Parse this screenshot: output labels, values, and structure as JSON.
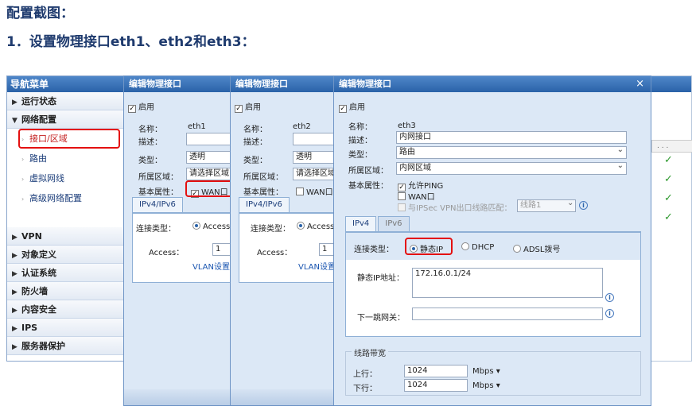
{
  "doc": {
    "title": "配置截图：",
    "subtitle": "1．设置物理接口eth1、eth2和eth3："
  },
  "nav": {
    "header": "导航菜单",
    "sections_top": [
      {
        "label": "运行状态",
        "expanded": false
      },
      {
        "label": "网络配置",
        "expanded": true
      }
    ],
    "sub_items": [
      "接口/区域",
      "路由",
      "虚拟网线",
      "高级网络配置"
    ],
    "sections_bottom": [
      "VPN",
      "对象定义",
      "认证系统",
      "防火墙",
      "内容安全",
      "IPS",
      "服务器保护"
    ]
  },
  "grid": {
    "header": ". . .",
    "checks": [
      "✓",
      "✓",
      "✓",
      "✓"
    ]
  },
  "dialog1": {
    "title": "编辑物理接口",
    "enable": "启用",
    "name_label": "名称：",
    "name_value": "eth1",
    "desc_label": "描述：",
    "type_label": "类型：",
    "type_value": "透明",
    "zone_label": "所属区域：",
    "zone_value": "请选择区域",
    "attr_label": "基本属性：",
    "wan_label": "WAN口",
    "tab": "IPv4/IPv6",
    "conn_label": "连接类型：",
    "conn_value": "Access",
    "access_label": "Access：",
    "access_value": "1",
    "vlan_link": "VLAN设置"
  },
  "dialog2": {
    "title": "编辑物理接口",
    "enable": "启用",
    "name_label": "名称：",
    "name_value": "eth2",
    "desc_label": "描述：",
    "type_label": "类型：",
    "type_value": "透明",
    "zone_label": "所属区域：",
    "zone_value": "请选择区域",
    "attr_label": "基本属性：",
    "wan_label": "WAN口",
    "tab": "IPv4/IPv6",
    "conn_label": "连接类型：",
    "conn_value": "Access",
    "access_label": "Access：",
    "access_value": "1",
    "vlan_link": "VLAN设置"
  },
  "dialog3": {
    "title": "编辑物理接口",
    "close": "×",
    "enable": "启用",
    "name_label": "名称：",
    "name_value": "eth3",
    "desc_label": "描述：",
    "desc_value": "内网接口",
    "type_label": "类型：",
    "type_value": "路由",
    "zone_label": "所属区域：",
    "zone_value": "内网区域",
    "attr_label": "基本属性：",
    "ping_label": "允许PING",
    "wan_label": "WAN口",
    "vpn_label": "与IPSec VPN出口线路匹配：",
    "vpn_value": "线路1",
    "tab_ipv4": "IPv4",
    "tab_ipv6": "IPv6",
    "conn_label": "连接类型：",
    "conn_static": "静态IP",
    "conn_dhcp": "DHCP",
    "conn_adsl": "ADSL拨号",
    "ip_label": "静态IP地址：",
    "ip_value": "172.16.0.1/24",
    "gw_label": "下一跳网关：",
    "bw_legend": "线路带宽",
    "up_label": "上行：",
    "up_value": "1024",
    "up_unit": "Mbps",
    "down_label": "下行：",
    "down_value": "1024",
    "down_unit": "Mbps"
  }
}
